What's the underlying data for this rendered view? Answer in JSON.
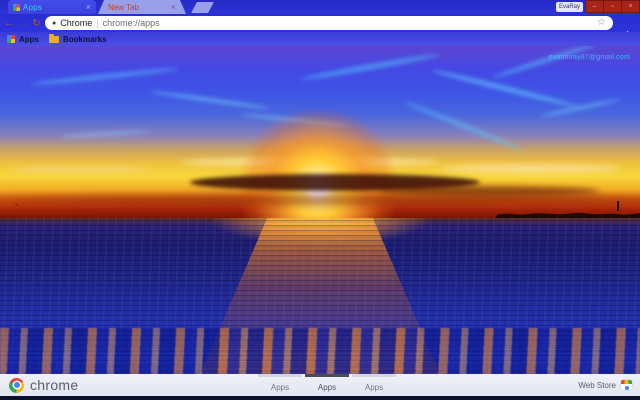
{
  "window": {
    "profile_button_label": "EvaRay",
    "controls": {
      "minimize": "–",
      "maximize": "▫",
      "close": "×"
    }
  },
  "tab_strip": {
    "tabs": [
      {
        "label": "Apps",
        "close": "×",
        "active": true
      },
      {
        "label": "New Tab",
        "close": "×",
        "active": false
      }
    ]
  },
  "toolbar": {
    "back_icon": "←",
    "forward_icon": "→",
    "refresh_icon": "↻",
    "address_bar": {
      "site_icon": "●",
      "site_name": "Chrome",
      "separator": "|",
      "url": "chrome://apps",
      "bookmark_star": "☆"
    },
    "menu_icon": "⋮"
  },
  "bookmarks_bar": {
    "items": [
      {
        "label": "Apps",
        "icon": "apps-grid-icon"
      },
      {
        "label": "Bookmarks",
        "icon": "folder-icon"
      }
    ]
  },
  "page": {
    "scene": "sunset over sea with cirrus clouds",
    "watermark": "evatimray87@gmail.com",
    "bird_glyph": "˅"
  },
  "bottom_bar": {
    "brand": "chrome",
    "sections": [
      {
        "label": "Apps",
        "active": false
      },
      {
        "label": "Apps",
        "active": true
      },
      {
        "label": "Apps",
        "active": false
      }
    ],
    "web_store_label": "Web Store"
  },
  "theme_colors": {
    "frame_blue": "#2b30d2",
    "active_tab_blue": "#3c45e6",
    "inactive_tab_periwinkle": "#98a0ea",
    "tab_text_cyan": "#3ecbf2",
    "tab_text_orange": "#c8451a",
    "nav_icon_orange": "#b45a1c",
    "window_controls_red": "#a52619",
    "bookmark_text_navy": "#0d1238",
    "sky_blue": "#3f55e6",
    "cloud_cyan": "#5ad7ff",
    "sunset_yellow": "#f8d83c",
    "sunset_red": "#a82508",
    "sea_blue": "#1e2486",
    "reflection_orange": "#fa8219",
    "bottom_bar_bg": "#e8eaf4",
    "watermark_cyan": "#35d0f5"
  }
}
